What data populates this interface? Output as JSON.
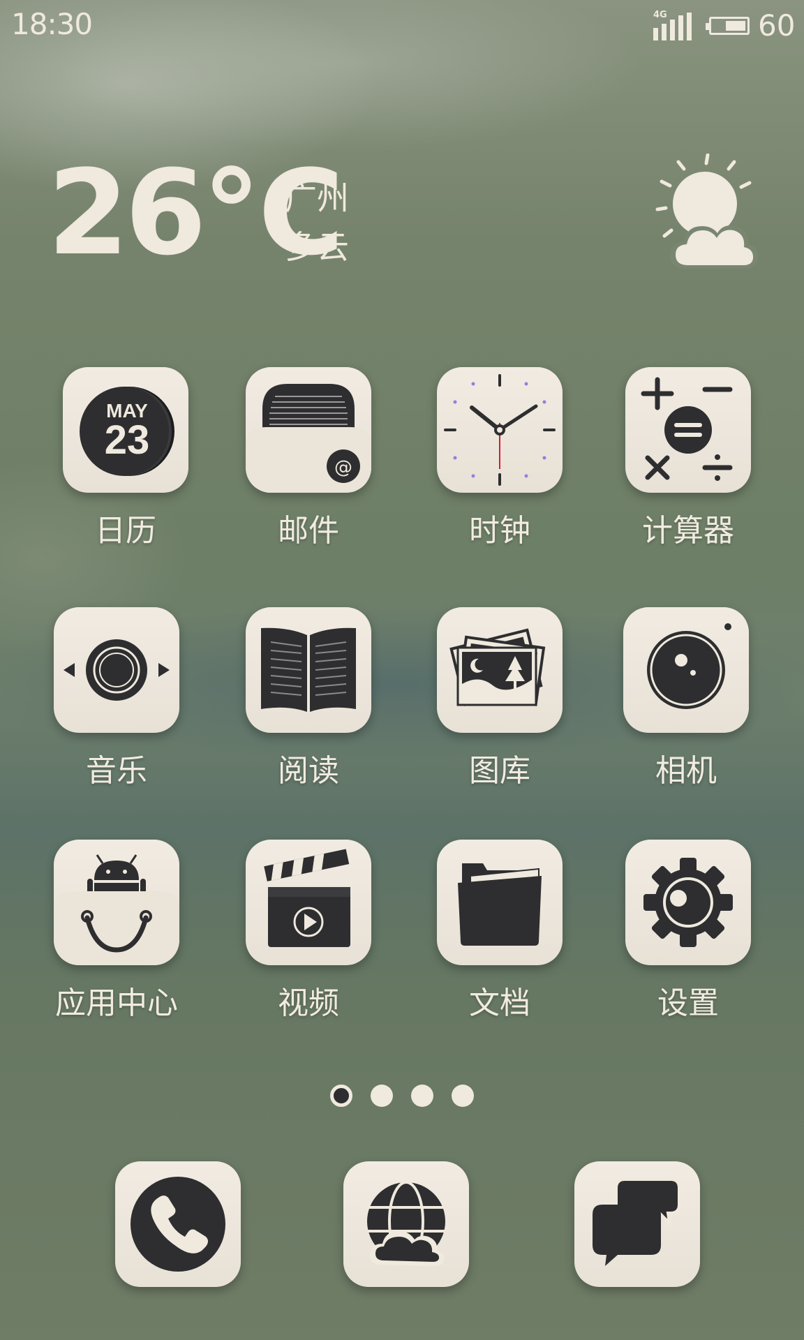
{
  "status_bar": {
    "time": "18:30",
    "network_type": "4G",
    "battery_level": "60"
  },
  "weather": {
    "temperature": "26℃",
    "city": "广州",
    "condition": "多云",
    "icon": "partly-cloudy-icon"
  },
  "apps": [
    {
      "label": "日历",
      "icon": "calendar-icon",
      "calendar_month": "MAY",
      "calendar_day": "23"
    },
    {
      "label": "邮件",
      "icon": "mail-icon"
    },
    {
      "label": "时钟",
      "icon": "clock-icon"
    },
    {
      "label": "计算器",
      "icon": "calculator-icon"
    },
    {
      "label": "音乐",
      "icon": "music-icon"
    },
    {
      "label": "阅读",
      "icon": "book-icon"
    },
    {
      "label": "图库",
      "icon": "gallery-icon"
    },
    {
      "label": "相机",
      "icon": "camera-icon"
    },
    {
      "label": "应用中心",
      "icon": "app-store-icon"
    },
    {
      "label": "视频",
      "icon": "video-icon"
    },
    {
      "label": "文档",
      "icon": "folder-icon"
    },
    {
      "label": "设置",
      "icon": "settings-icon"
    }
  ],
  "page_indicator": {
    "total_pages": 4,
    "current_page": 1
  },
  "dock": [
    {
      "icon": "phone-icon"
    },
    {
      "icon": "browser-icon"
    },
    {
      "icon": "messages-icon"
    }
  ],
  "colors": {
    "tile": "#efe9e0",
    "icon_dark": "#2e2e30",
    "label_text": "#f1ebe0",
    "clock_second_hand": "#d8173a",
    "clock_dots": "#9a7be0"
  }
}
